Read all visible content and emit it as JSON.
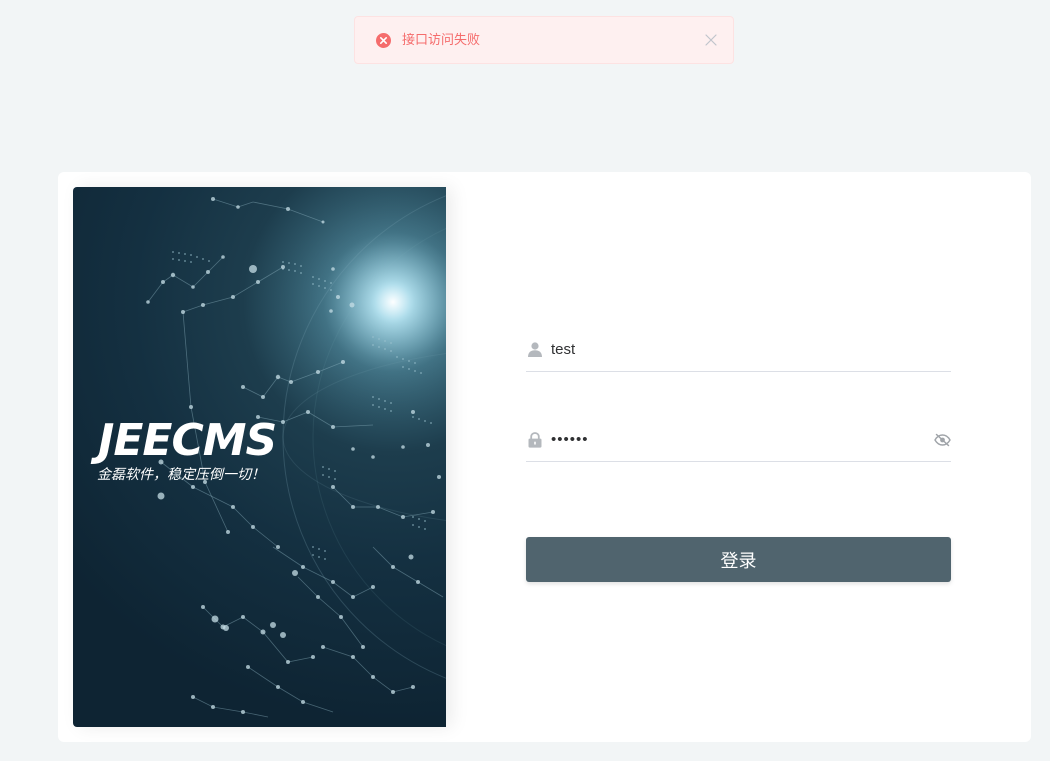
{
  "toast": {
    "type": "error",
    "message": "接口访问失败",
    "icon": "error-circle-icon",
    "close_icon": "close-icon"
  },
  "banner": {
    "brand": "JEECMS",
    "slogan": "金磊软件，稳定压倒一切！"
  },
  "login": {
    "username": {
      "icon": "user-icon",
      "value": "test"
    },
    "password": {
      "icon": "lock-icon",
      "value": "••••••",
      "toggle_icon": "eye-off-icon"
    },
    "submit_label": "登录"
  },
  "colors": {
    "page_bg": "#f2f5f6",
    "toast_bg": "#fef0f0",
    "toast_text": "#f56c6c",
    "button_bg": "#50646e",
    "banner_dark": "#0e2433"
  }
}
